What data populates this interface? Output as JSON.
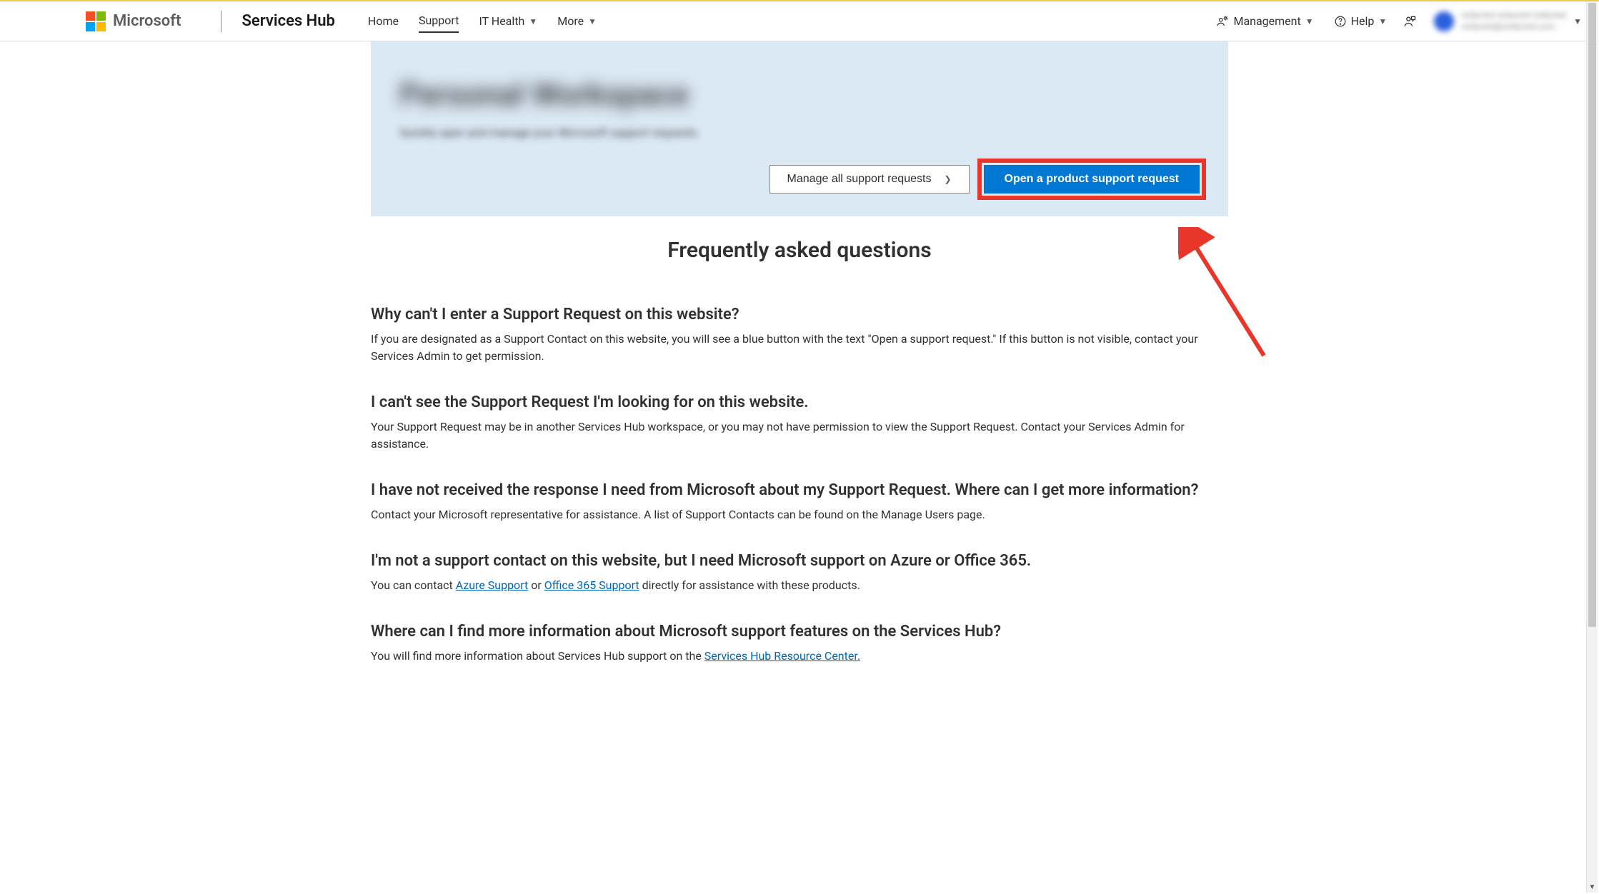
{
  "brand": {
    "company": "Microsoft",
    "product": "Services Hub"
  },
  "nav": {
    "home": "Home",
    "support": "Support",
    "ithealth": "IT Health",
    "more": "More",
    "management": "Management",
    "help": "Help"
  },
  "user": {
    "line1": "redacted redacted redacted",
    "line2": "redacted@redacted.com"
  },
  "hero": {
    "title": "Personal Workspace",
    "subtitle": "Quickly open and manage your Microsoft support requests.",
    "manage_btn": "Manage all support requests",
    "open_btn": "Open a product support request"
  },
  "faq": {
    "heading": "Frequently asked questions",
    "items": [
      {
        "q": "Why can't I enter a Support Request on this website?",
        "a": "If you are designated as a Support Contact on this website, you will see a blue button with the text \"Open a support request.\" If this button is not visible, contact your Services Admin to get permission."
      },
      {
        "q": "I can't see the Support Request I'm looking for on this website.",
        "a": "Your Support Request may be in another Services Hub workspace, or you may not have permission to view the Support Request. Contact your Services Admin for assistance."
      },
      {
        "q": "I have not received the response I need from Microsoft about my Support Request. Where can I get more information?",
        "a": "Contact your Microsoft representative for assistance. A list of Support Contacts can be found on the Manage Users page."
      },
      {
        "q": "I'm not a support contact on this website, but I need Microsoft support on Azure or Office 365.",
        "a_pre": "You can contact ",
        "a_link1": "Azure Support",
        "a_mid": " or ",
        "a_link2": "Office 365 Support",
        "a_post": " directly for assistance with these products."
      },
      {
        "q": "Where can I find more information about Microsoft support features on the Services Hub?",
        "a_pre": "You will find more information about Services Hub support on the ",
        "a_link1": "Services Hub Resource Center."
      }
    ]
  }
}
